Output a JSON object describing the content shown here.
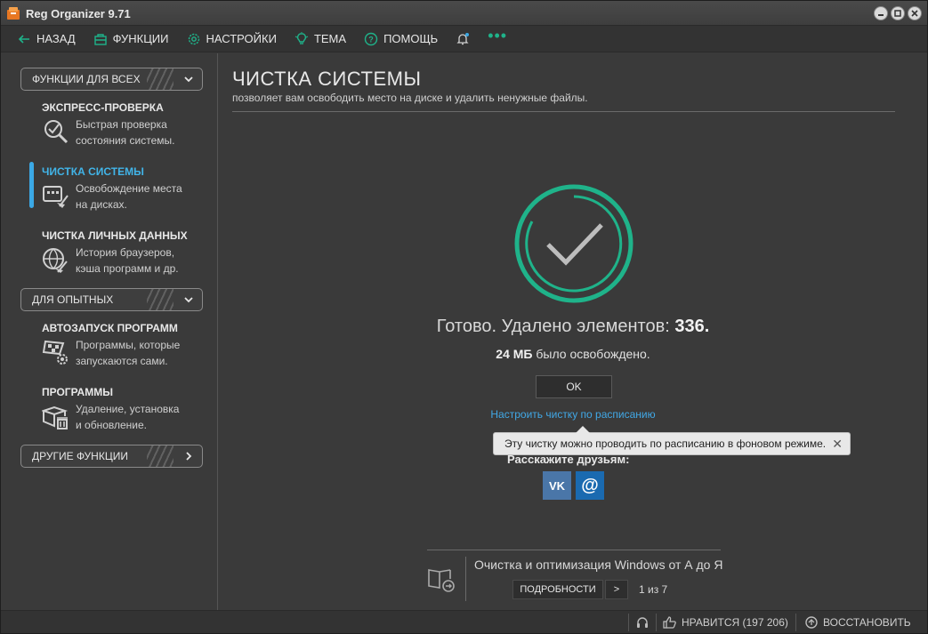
{
  "window": {
    "title": "Reg Organizer 9.71"
  },
  "menu": {
    "back": "НАЗАД",
    "functions": "ФУНКЦИИ",
    "settings": "НАСТРОЙКИ",
    "theme": "ТЕМА",
    "help": "ПОМОЩЬ",
    "more": "•••"
  },
  "sidebar": {
    "group_all": "ФУНКЦИИ ДЛЯ ВСЕХ",
    "group_advanced": "ДЛЯ ОПЫТНЫХ",
    "group_other": "ДРУГИЕ ФУНКЦИИ",
    "items": [
      {
        "title": "ЭКСПРЕСС-ПРОВЕРКА",
        "desc1": "Быстрая проверка",
        "desc2": "состояния системы."
      },
      {
        "title": "ЧИСТКА СИСТЕМЫ",
        "desc1": "Освобождение места",
        "desc2": "на дисках."
      },
      {
        "title": "ЧИСТКА ЛИЧНЫХ ДАННЫХ",
        "desc1": "История браузеров,",
        "desc2": "кэша программ и др."
      },
      {
        "title": "АВТОЗАПУСК ПРОГРАММ",
        "desc1": "Программы, которые",
        "desc2": "запускаются сами."
      },
      {
        "title": "ПРОГРАММЫ",
        "desc1": "Удаление, установка",
        "desc2": "и обновление."
      }
    ]
  },
  "main": {
    "title": "ЧИСТКА СИСТЕМЫ",
    "subtitle": "позволяет вам освободить место на диске и удалить ненужные файлы.",
    "result_prefix": "Готово. Удалено элементов: ",
    "result_count": "336.",
    "freed_amount": "24 МБ",
    "freed_suffix": " было освобождено.",
    "ok_label": "OK",
    "schedule_link": "Настроить чистку по расписанию",
    "tooltip": "Эту чистку можно проводить по расписанию в фоновом режиме.",
    "tooltip_close": "✕",
    "share_label": "Расскажите друзьям:",
    "share_vk": "VK",
    "share_mail": "@"
  },
  "tip": {
    "title": "Очистка и оптимизация Windows от А до Я",
    "details_label": "ПОДРОБНОСТИ",
    "next_label": ">",
    "counter": "1 из 7"
  },
  "statusbar": {
    "like": "НРАВИТСЯ (197 206)",
    "restore": "ВОССТАНОВИТЬ"
  },
  "colors": {
    "accent_green": "#1fb38a",
    "accent_blue": "#3ba9e6",
    "background": "#3a3a3a"
  }
}
